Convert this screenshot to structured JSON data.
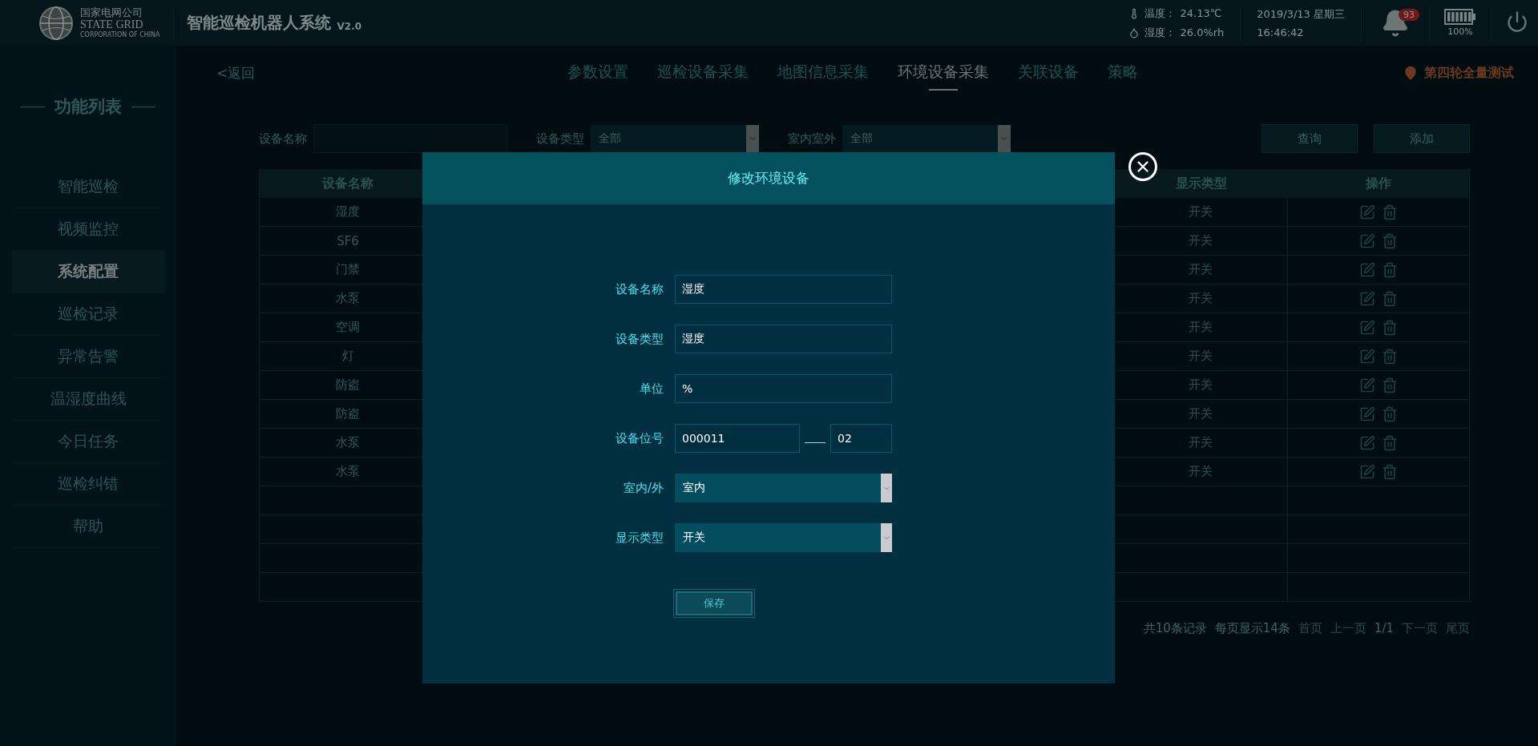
{
  "header": {
    "logo": {
      "line_1": "国家电网公司",
      "line_2": "STATE GRID",
      "line_3": "CORPORATION OF CHINA"
    },
    "title": "智能巡检机器人系统",
    "version": "V2.0",
    "temperature": {
      "label": "温度：",
      "value": "24.13℃"
    },
    "humidity": {
      "label": "湿度：",
      "value": "26.0%rh"
    },
    "date": "2019/3/13 星期三",
    "time": "16:46:42",
    "alarm_count": "93",
    "battery": "100%"
  },
  "nav": {
    "back": "<返回",
    "tabs": [
      {
        "label": "参数设置",
        "selected": false
      },
      {
        "label": "巡检设备采集",
        "selected": false
      },
      {
        "label": "地图信息采集",
        "selected": false
      },
      {
        "label": "环境设备采集",
        "selected": true
      },
      {
        "label": "关联设备",
        "selected": false
      },
      {
        "label": "策略",
        "selected": false
      }
    ],
    "location": "第四轮全量测试"
  },
  "sidebar": {
    "title": "功能列表",
    "items": [
      {
        "label": "智能巡检",
        "selected": false
      },
      {
        "label": "视频监控",
        "selected": false
      },
      {
        "label": "系统配置",
        "selected": true
      },
      {
        "label": "巡检记录",
        "selected": false
      },
      {
        "label": "异常告警",
        "selected": false
      },
      {
        "label": "温湿度曲线",
        "selected": false
      },
      {
        "label": "今日任务",
        "selected": false
      },
      {
        "label": "巡检纠错",
        "selected": false
      },
      {
        "label": "帮助",
        "selected": false
      }
    ]
  },
  "filters": {
    "name_label": "设备名称",
    "type_label": "设备类型",
    "type_value": "全部",
    "location_label": "室内室外",
    "location_value": "全部",
    "buttons": [
      "查询",
      "添加"
    ]
  },
  "table": {
    "columns": [
      "设备名称",
      "显示类型",
      "操作"
    ],
    "rows": [
      {
        "name": "湿度",
        "display_type": "开关"
      },
      {
        "name": "SF6",
        "display_type": "开关"
      },
      {
        "name": "门禁",
        "display_type": "开关"
      },
      {
        "name": "水泵",
        "display_type": "开关"
      },
      {
        "name": "空调",
        "display_type": "开关"
      },
      {
        "name": "灯",
        "display_type": "开关"
      },
      {
        "name": "防盗",
        "display_type": "开关"
      },
      {
        "name": "防盗",
        "display_type": "开关"
      },
      {
        "name": "水泵",
        "display_type": "开关"
      },
      {
        "name": "水泵",
        "display_type": "开关"
      }
    ]
  },
  "pagination": {
    "total": "共10条记录",
    "per_page": "每页显示14条",
    "first": "首页",
    "prev": "上一页",
    "page": "1/1",
    "next": "下一页",
    "last": "尾页"
  },
  "modal": {
    "title": "修改环境设备",
    "fields": [
      {
        "kind": "text",
        "label": "设备名称",
        "value": "湿度"
      },
      {
        "kind": "text",
        "label": "设备类型",
        "value": "湿度"
      },
      {
        "kind": "text",
        "label": "单位",
        "value": "%"
      },
      {
        "kind": "split",
        "label": "设备位号",
        "value": "000011",
        "value_2": "02"
      },
      {
        "kind": "select",
        "label": "室内/外",
        "value": "室内"
      },
      {
        "kind": "select",
        "label": "显示类型",
        "value": "开关"
      }
    ],
    "save": "保存"
  }
}
